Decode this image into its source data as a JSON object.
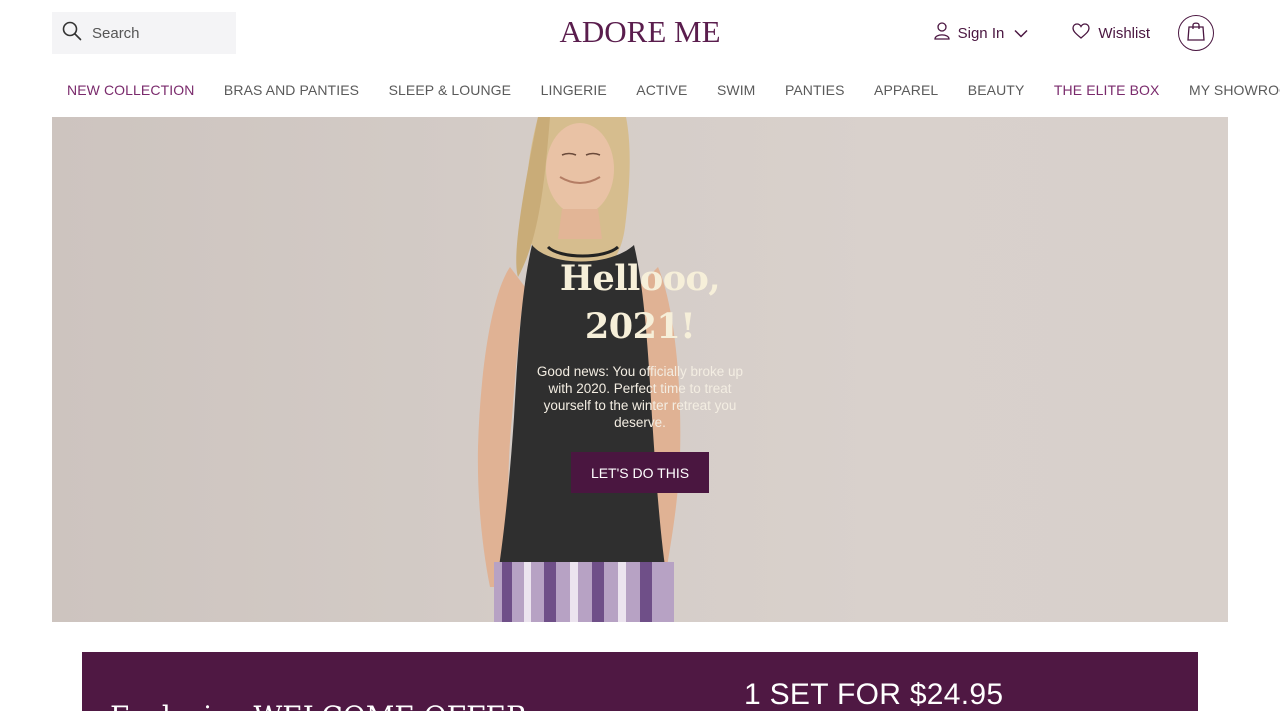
{
  "header": {
    "search_placeholder": "Search",
    "logo": "ADORE ME",
    "sign_in_label": "Sign In",
    "wishlist_label": "Wishlist"
  },
  "nav": {
    "items": [
      "NEW COLLECTION",
      "BRAS AND PANTIES",
      "SLEEP & LOUNGE",
      "LINGERIE",
      "ACTIVE",
      "SWIM",
      "PANTIES",
      "APPAREL",
      "BEAUTY",
      "THE ELITE BOX",
      "MY SHOWROOM"
    ]
  },
  "hero": {
    "title_line1": "Hellooo,",
    "title_line2": "2021!",
    "body": "Good news: You officially broke up with 2020. Perfect time to treat yourself to the winter retreat you deserve.",
    "cta_label": "LET'S DO THIS"
  },
  "promo": {
    "offer": "Exclusive WELCOME OFFER",
    "price": "1 SET FOR $24.95"
  },
  "colors": {
    "brand": "#4a1640",
    "accent_nav": "#7a2a6c",
    "hero_title": "#f6efd9"
  },
  "icons": {
    "search": "search-icon",
    "user": "user-icon",
    "chevron": "chevron-down-icon",
    "heart": "heart-icon",
    "bag": "shopping-bag-icon"
  }
}
